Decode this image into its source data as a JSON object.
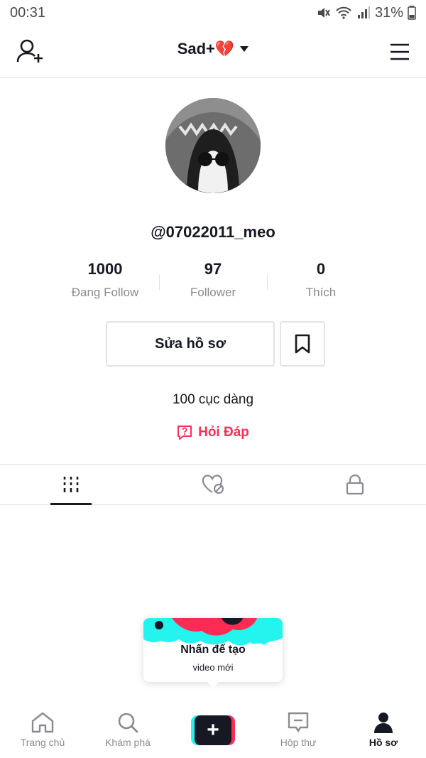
{
  "status_bar": {
    "time": "00:31",
    "battery": "31%"
  },
  "header": {
    "title": "Sad+💔"
  },
  "profile": {
    "username": "@07022011_meo",
    "stats": [
      {
        "value": "1000",
        "label": "Đang Follow"
      },
      {
        "value": "97",
        "label": "Follower"
      },
      {
        "value": "0",
        "label": "Thích"
      }
    ],
    "edit_button": "Sửa hồ sơ",
    "bio": "100 cục dàng",
    "qa_label": "Hỏi Đáp"
  },
  "colors": {
    "accent": "#fe2c55",
    "cyan": "#25f4ee",
    "text": "#161823",
    "muted": "#8a8b91"
  },
  "tooltip": {
    "title": "Nhấn để tạo",
    "subtitle": "video mới"
  },
  "bottom_nav": {
    "items": [
      {
        "label": "Trang chủ",
        "icon": "home-icon"
      },
      {
        "label": "Khám phá",
        "icon": "search-icon"
      },
      {
        "label": "",
        "icon": "plus-icon"
      },
      {
        "label": "Hộp thư",
        "icon": "inbox-icon"
      },
      {
        "label": "Hồ sơ",
        "icon": "profile-icon",
        "active": true
      }
    ]
  }
}
